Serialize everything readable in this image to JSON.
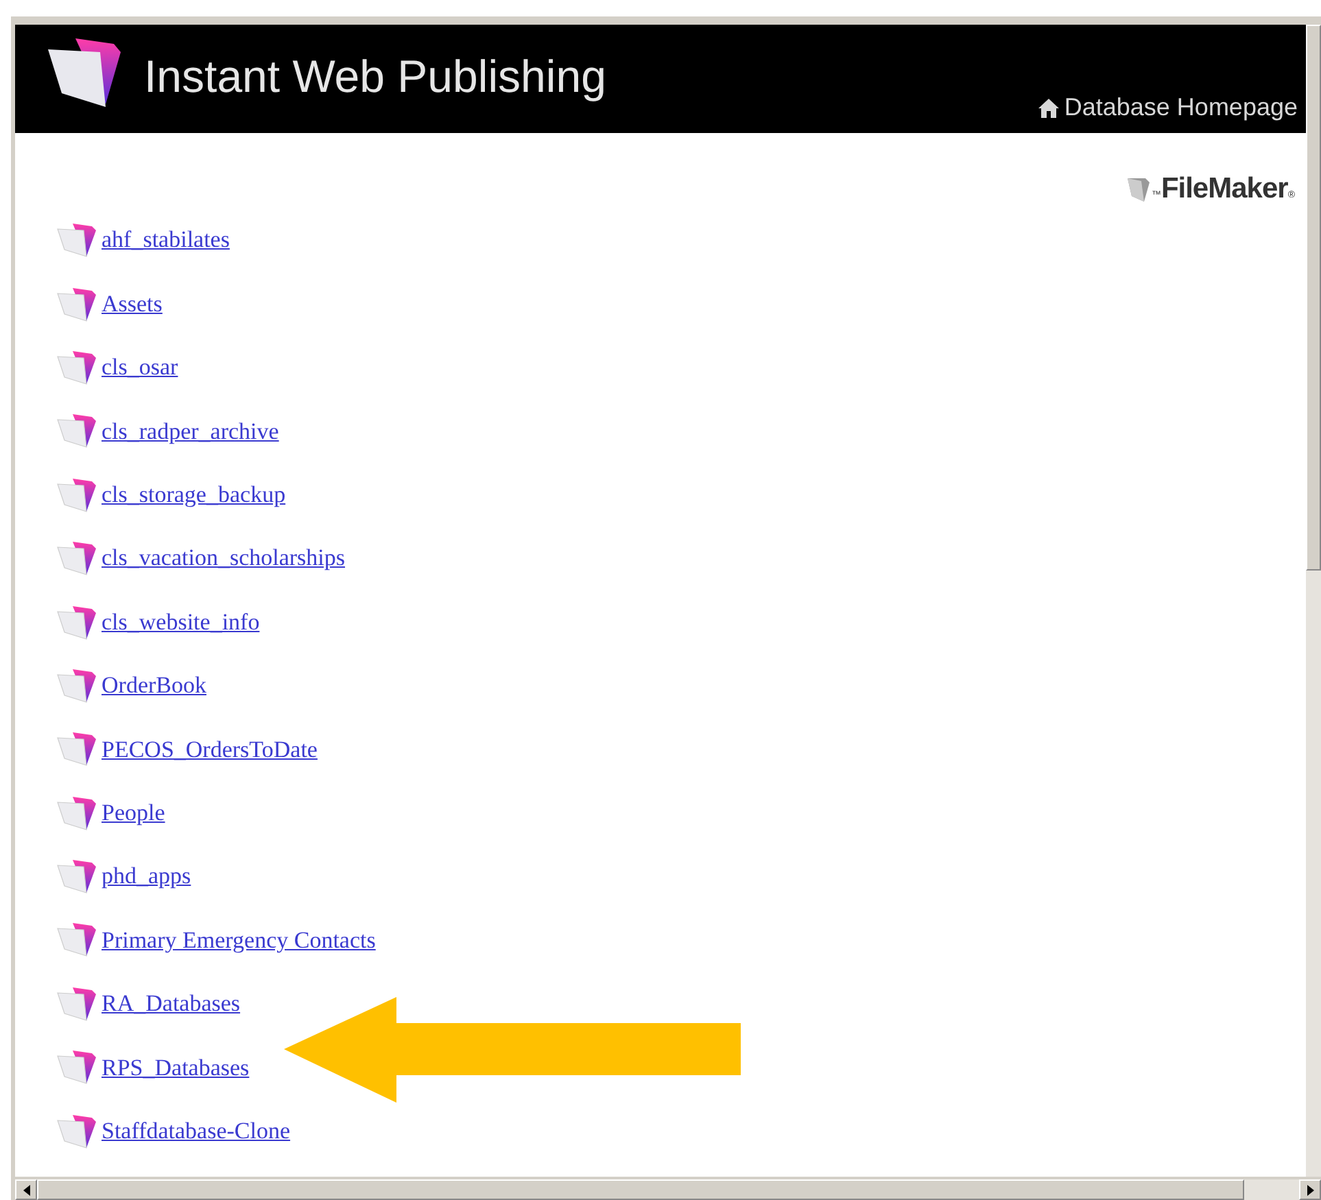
{
  "header": {
    "title": "Instant Web Publishing",
    "home_link": "Database Homepage"
  },
  "logo": {
    "text": "FileMaker",
    "trademark": "™",
    "registered": "®"
  },
  "databases": [
    {
      "name": "ahf_stabilates",
      "highlighted": false
    },
    {
      "name": "Assets",
      "highlighted": false
    },
    {
      "name": "cls_osar",
      "highlighted": false
    },
    {
      "name": "cls_radper_archive",
      "highlighted": false
    },
    {
      "name": "cls_storage_backup",
      "highlighted": false
    },
    {
      "name": "cls_vacation_scholarships",
      "highlighted": false
    },
    {
      "name": "cls_website_info",
      "highlighted": false
    },
    {
      "name": "OrderBook",
      "highlighted": false
    },
    {
      "name": "PECOS_OrdersToDate",
      "highlighted": false
    },
    {
      "name": "People",
      "highlighted": false
    },
    {
      "name": "phd_apps",
      "highlighted": false
    },
    {
      "name": "Primary Emergency Contacts",
      "highlighted": false
    },
    {
      "name": "RA_Databases",
      "highlighted": false
    },
    {
      "name": "RPS_Databases",
      "highlighted": true
    },
    {
      "name": "Staffdatabase-Clone",
      "highlighted": false
    }
  ]
}
